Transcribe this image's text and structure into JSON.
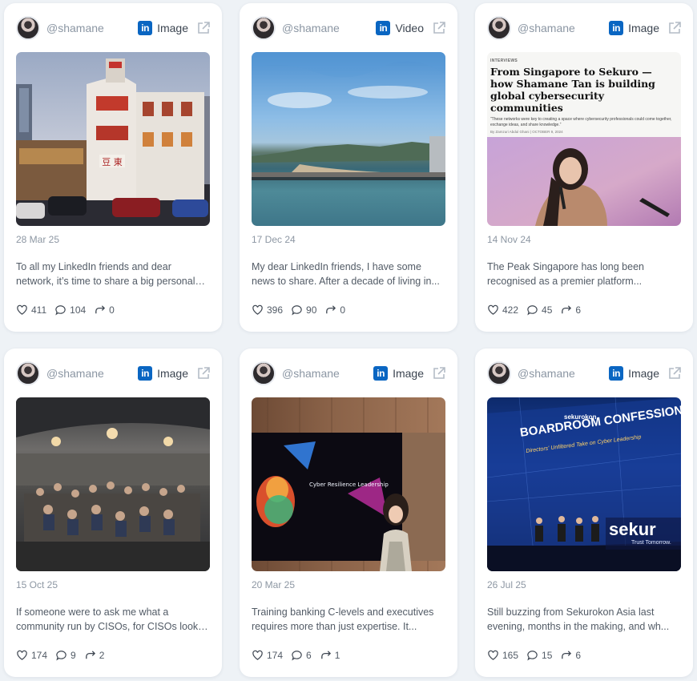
{
  "cards": [
    {
      "handle": "@shamane",
      "media_type": "Image",
      "date": "28 Mar 25",
      "text": "To all my LinkedIn friends and dear network, it’s time to share a big personal update...",
      "likes": "411",
      "comments": "104",
      "shares": "0"
    },
    {
      "handle": "@shamane",
      "media_type": "Video",
      "date": "17 Dec 24",
      "text": "My dear LinkedIn friends, I have some news to share. After a decade of living in...",
      "likes": "396",
      "comments": "90",
      "shares": "0"
    },
    {
      "handle": "@shamane",
      "media_type": "Image",
      "date": "14 Nov 24",
      "text": "The Peak Singapore has long been recognised as a premier platform...",
      "likes": "422",
      "comments": "45",
      "shares": "6",
      "article": {
        "kicker": "INTERVIEWS",
        "headline": "From Singapore to Sekuro — how Shamane Tan is building global cybersecurity communities",
        "quote": "“These networks were key to creating a space where cybersecurity professionals could come together, exchange ideas, and share knowledge.”",
        "byline": "By Zamzuri Abdul Ghani  |  OCTOBER 9, 2024"
      }
    },
    {
      "handle": "@shamane",
      "media_type": "Image",
      "date": "15 Oct 25",
      "text": "If someone were to ask me what a community run by CISOs, for CISOs looks like...",
      "likes": "174",
      "comments": "9",
      "shares": "2"
    },
    {
      "handle": "@shamane",
      "media_type": "Image",
      "date": "20 Mar 25",
      "text": "Training banking C-levels and executives requires more than just expertise. It...",
      "likes": "174",
      "comments": "6",
      "shares": "1",
      "screen_title": "Cyber Resilience Leadership"
    },
    {
      "handle": "@shamane",
      "media_type": "Image",
      "date": "26 Jul 25",
      "text": "Still buzzing from Sekurokon Asia last evening, months in the making, and wh...",
      "likes": "165",
      "comments": "15",
      "shares": "6",
      "stage": {
        "event": "sekurokon",
        "headline": "BOARDROOM CONFESSIONS",
        "subhead": "Directors' Unfiltered Take on Cyber Leadership",
        "brand": "sekur",
        "tagline": "Trust Tomorrow."
      }
    }
  ],
  "colors": {
    "linkedin": "#0a66c2",
    "muted": "#8d97a3",
    "body_text": "#525b66"
  },
  "icons": [
    "linkedin-icon",
    "external-link-icon",
    "heart-icon",
    "comment-icon",
    "share-icon"
  ]
}
